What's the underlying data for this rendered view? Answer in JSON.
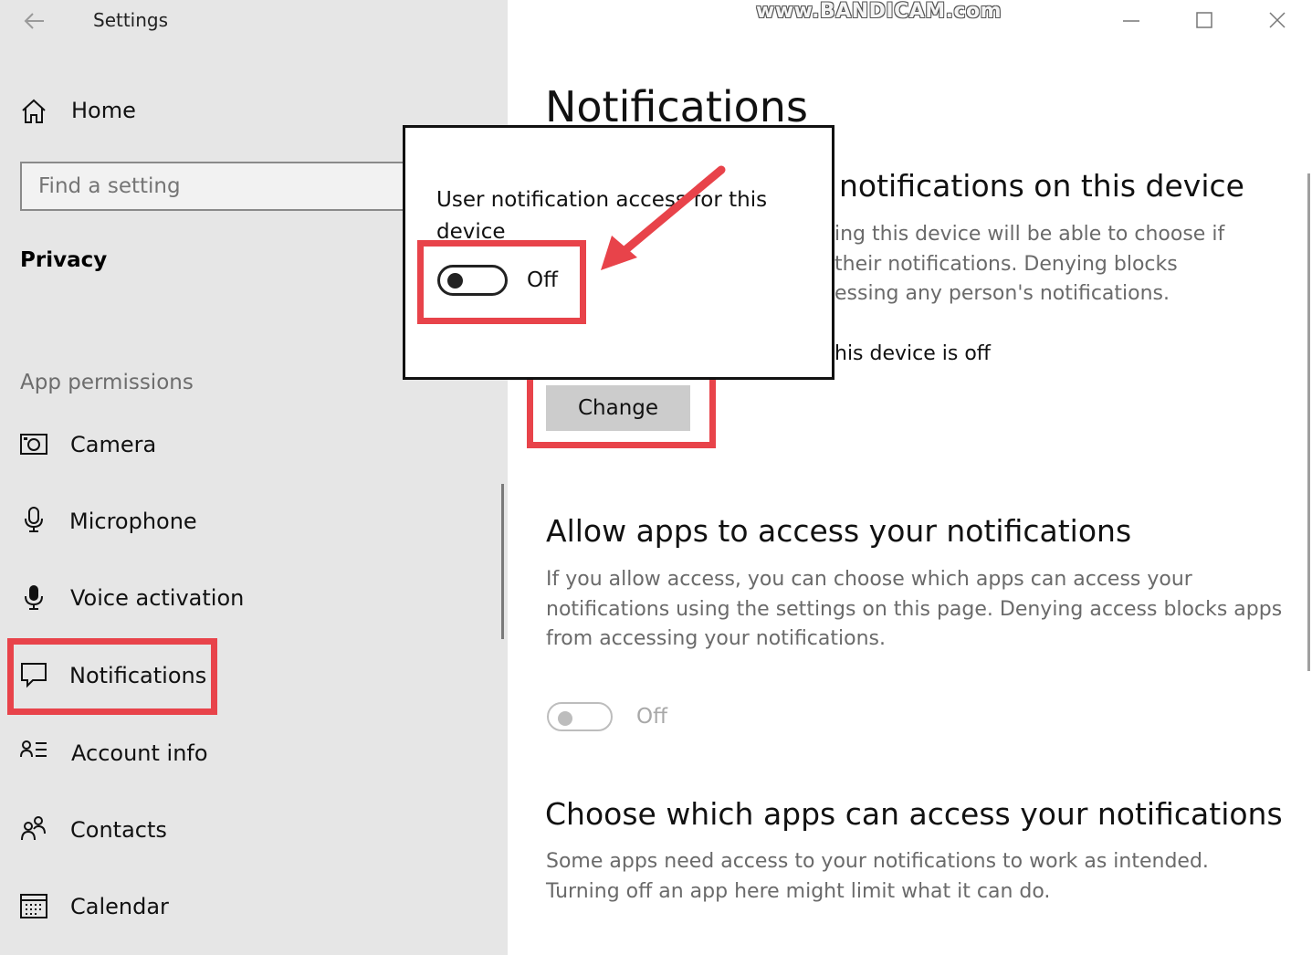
{
  "window": {
    "title": "Settings",
    "watermark": "www.BANDICAM.com"
  },
  "sidebar": {
    "home": "Home",
    "search_placeholder": "Find a setting",
    "section": "Privacy",
    "group_label": "App permissions",
    "items": [
      {
        "label": "Camera",
        "icon": "camera-icon"
      },
      {
        "label": "Microphone",
        "icon": "microphone-icon"
      },
      {
        "label": "Voice activation",
        "icon": "voice-activation-icon"
      },
      {
        "label": "Notifications",
        "icon": "notifications-icon",
        "selected": true
      },
      {
        "label": "Account info",
        "icon": "account-info-icon"
      },
      {
        "label": "Contacts",
        "icon": "contacts-icon"
      },
      {
        "label": "Calendar",
        "icon": "calendar-icon"
      }
    ]
  },
  "main": {
    "title": "Notifications",
    "device_heading": "notifications on this device",
    "device_desc_lines": [
      "ing this device will be able to choose if",
      "their notifications. Denying blocks",
      "essing any person's notifications."
    ],
    "device_status": "his device is off",
    "change_label": "Change",
    "apps_heading": "Allow apps to access your notifications",
    "apps_desc_lines": [
      "If you allow access, you can choose which apps can access your",
      "notifications using the settings on this page. Denying access blocks apps",
      "from accessing your notifications."
    ],
    "apps_toggle_label": "Off",
    "apps_toggle_on": false,
    "choose_heading": "Choose which apps can access your notifications",
    "choose_desc_lines": [
      "Some apps need access to your notifications to work as intended.",
      "Turning off an app here might limit what it can do."
    ]
  },
  "popup": {
    "text": "User notification access for this device",
    "toggle_label": "Off",
    "toggle_on": false
  },
  "colors": {
    "highlight": "#e8434a",
    "sidebar_bg": "#e6e6e6"
  }
}
